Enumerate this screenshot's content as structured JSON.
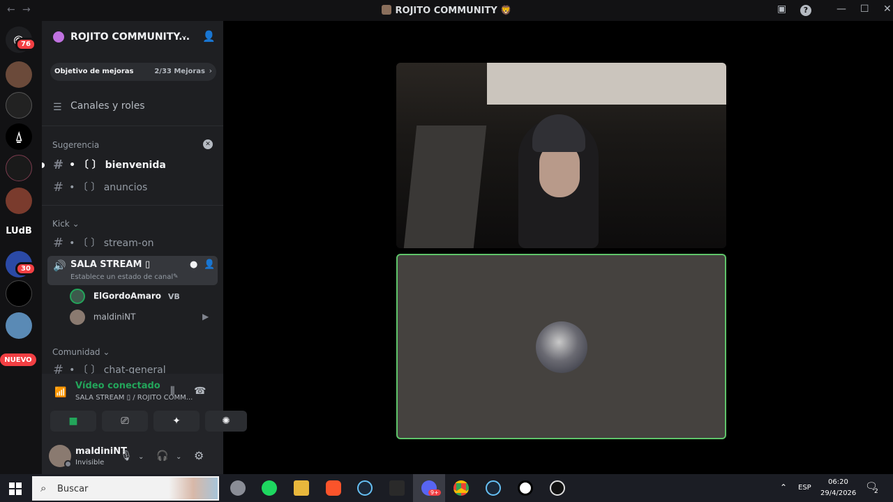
{
  "window": {
    "title": "ROJITO COMMUNITY 🦁",
    "back": "←",
    "forward": "→"
  },
  "rail": {
    "home_badge": "76",
    "lol_badge": "30",
    "ludb_label": "LUdB",
    "new_label": "NUEVO"
  },
  "server": {
    "name": "ROJITO COMMUNITY...",
    "boost_label": "Objetivo de mejoras",
    "boost_count": "2/33 Mejoras",
    "channels_roles": "Canales y roles"
  },
  "categories": {
    "suggestion": "Sugerencia",
    "kick": "Kick",
    "community": "Comunidad"
  },
  "channels": {
    "bienvenida": "• 〔 〕 bienvenida",
    "anuncios": "• 〔 〕 anuncios",
    "stream_on": "• 〔 〕 stream-on",
    "chat_general": "• 〔 〕 chat-general"
  },
  "voice_channel": {
    "name": "SALA STREAM ▯",
    "status": "Establece un estado de canal",
    "users": [
      {
        "name": "ElGordoAmaro",
        "tag": "VB"
      },
      {
        "name": "maldiniNT"
      }
    ]
  },
  "voice_panel": {
    "connected": "Vídeo conectado",
    "location": "SALA STREAM ▯ / ROJITO COMM..."
  },
  "user": {
    "name": "maldiniNT",
    "status": "Invisible"
  },
  "taskbar": {
    "search_placeholder": "Buscar",
    "lang": "ESP",
    "time": "06:20",
    "date": "29/4/2026",
    "notif_count": "2",
    "discord_badge": "9+"
  },
  "colors": {
    "speaking_border": "#5fc46a",
    "connected_green": "#23a55a",
    "badge_red": "#f23f43"
  }
}
